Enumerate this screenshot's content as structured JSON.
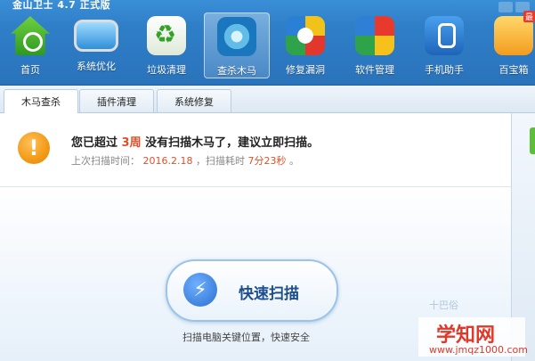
{
  "app": {
    "title": "金山卫士 4.7 正式版"
  },
  "toolbar": {
    "items": [
      {
        "label": "首页",
        "icon": "home-icon"
      },
      {
        "label": "系统优化",
        "icon": "monitor-icon"
      },
      {
        "label": "垃圾清理",
        "icon": "recycle-icon"
      },
      {
        "label": "查杀木马",
        "icon": "radar-icon",
        "active": true
      },
      {
        "label": "修复漏洞",
        "icon": "repair-ring-icon"
      },
      {
        "label": "软件管理",
        "icon": "software-cube-icon"
      },
      {
        "label": "手机助手",
        "icon": "phone-android-icon"
      },
      {
        "label": "百宝箱",
        "icon": "toolbox-icon",
        "badge": "最"
      }
    ]
  },
  "tabs": [
    {
      "label": "木马查杀",
      "active": true
    },
    {
      "label": "插件清理"
    },
    {
      "label": "系统修复"
    }
  ],
  "alert": {
    "icon": "warning-icon",
    "prefix": "您已超过",
    "days": "3周",
    "suffix": "没有扫描木马了，建议立即扫描。",
    "last_scan_label": "上次扫描时间：",
    "last_scan_date": "2016.2.18",
    "duration_label": "，扫描耗时",
    "duration_value": "7分23秒",
    "end": "。"
  },
  "scan": {
    "button_label": "快速扫描",
    "hint": "扫描电脑关键位置，快速安全"
  },
  "watermark": {
    "site_name": "学知网",
    "site_url": "www.jmqz1000.com",
    "faint_text": "十巴俗"
  },
  "colors": {
    "highlight": "#e0502a",
    "toolbar_bg": "#2f7fc8"
  }
}
